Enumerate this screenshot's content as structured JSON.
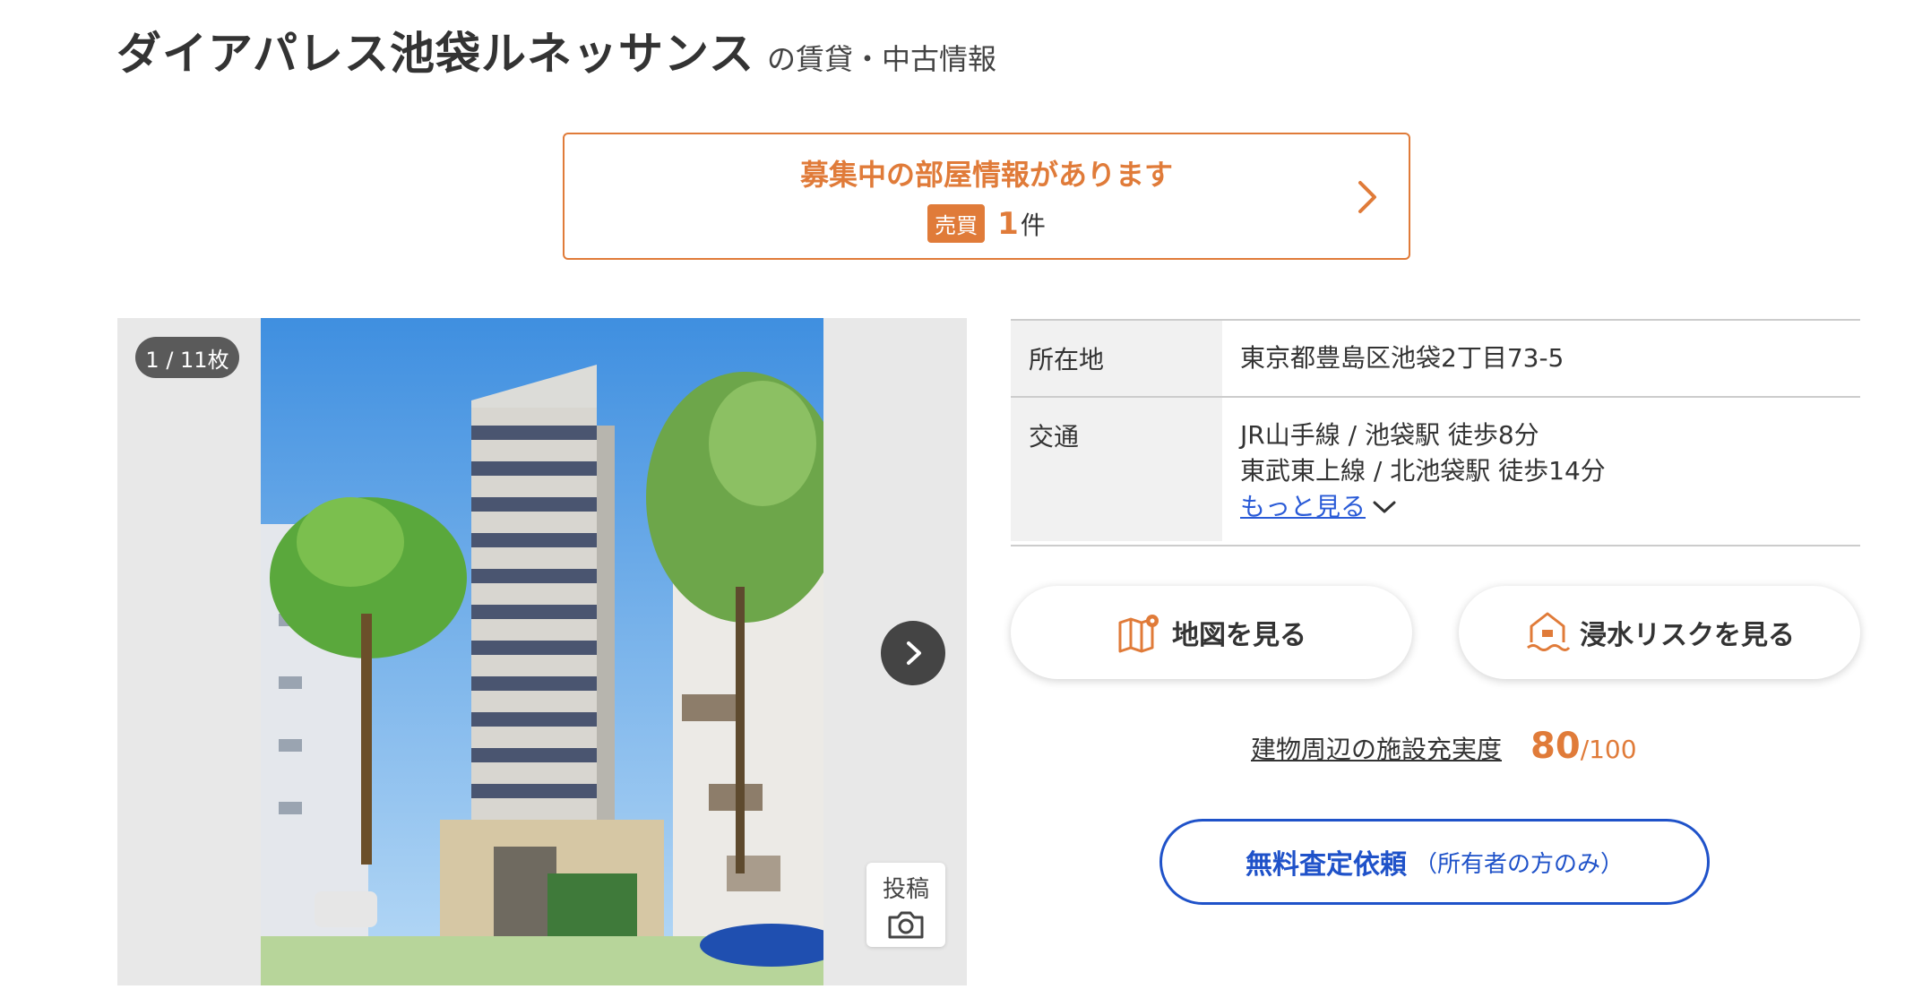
{
  "header": {
    "title": "ダイアパレス池袋ルネッサンス",
    "subtitle": "の賃貸・中古情報"
  },
  "recruit": {
    "title": "募集中の部屋情報があります",
    "badge": "売買",
    "count": "1",
    "unit": "件"
  },
  "gallery": {
    "counter": "1 / 11枚",
    "post_label": "投稿"
  },
  "info": {
    "address_label": "所在地",
    "address_value": "東京都豊島区池袋2丁目73-5",
    "transport_label": "交通",
    "transport_lines": [
      "JR山手線 / 池袋駅 徒歩8分",
      "東武東上線 / 北池袋駅 徒歩14分"
    ],
    "more_link": "もっと見る"
  },
  "actions": {
    "map_label": "地図を見る",
    "flood_label": "浸水リスクを見る"
  },
  "score": {
    "label": "建物周辺の施設充実度",
    "value": "80",
    "max": "/100"
  },
  "assess": {
    "main": "無料査定依頼",
    "sub": "（所有者の方のみ）"
  },
  "colors": {
    "accent": "#e07b39",
    "link": "#2a5bd7",
    "primary_blue": "#1f52c9"
  },
  "icons": {
    "recruit_arrow": "chevron-right-icon",
    "next": "chevron-right-icon",
    "camera": "camera-icon",
    "map": "map-icon",
    "flood": "house-water-icon",
    "more": "chevron-down-icon"
  }
}
